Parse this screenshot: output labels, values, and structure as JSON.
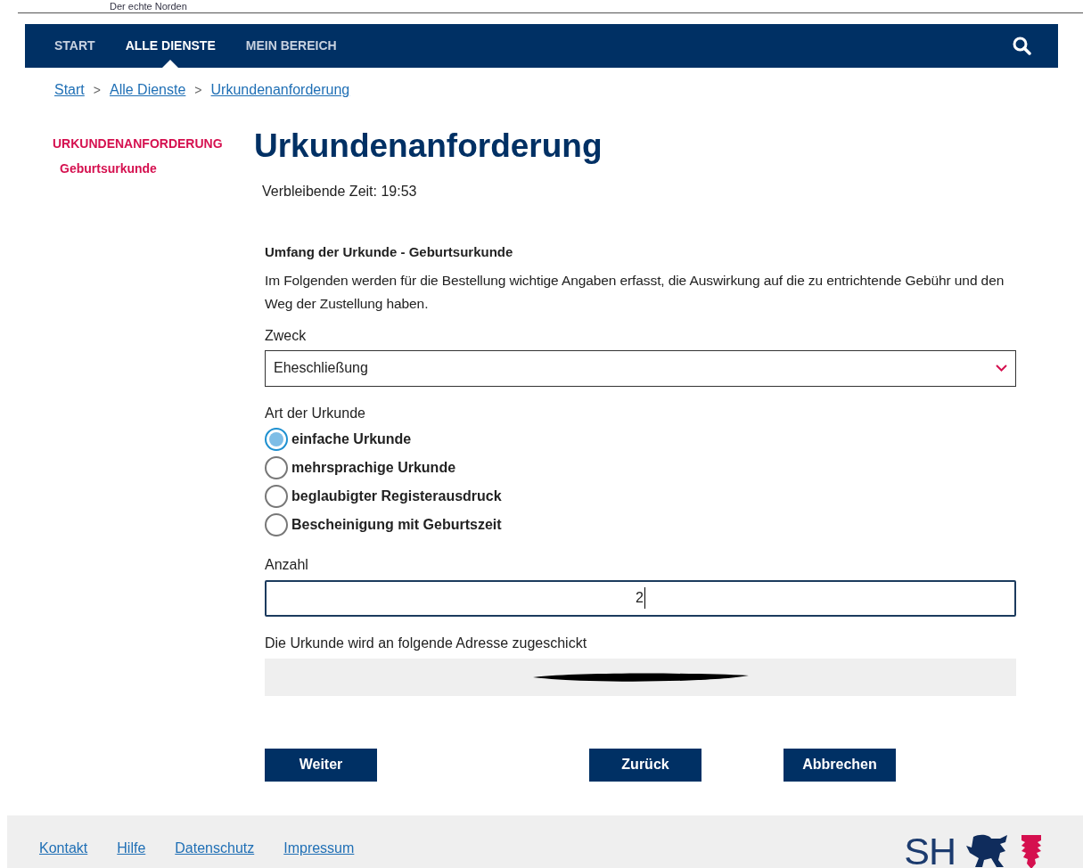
{
  "header": {
    "tagline": "Der echte Norden"
  },
  "nav": {
    "items": [
      {
        "label": "START",
        "selected": false
      },
      {
        "label": "ALLE DIENSTE",
        "selected": true
      },
      {
        "label": "MEIN BEREICH",
        "selected": false
      }
    ]
  },
  "breadcrumb": [
    "Start",
    "Alle Dienste",
    "Urkundenanforderung"
  ],
  "breadcrumb_separator": ">",
  "sidebar": {
    "title": "URKUNDENANFORDERUNG",
    "items": [
      "Geburtsurkunde"
    ]
  },
  "page": {
    "title": "Urkundenanforderung",
    "timer": "Verbleibende Zeit: 19:53"
  },
  "form": {
    "heading": "Umfang der Urkunde - Geburtsurkunde",
    "intro": "Im Folgenden werden für die Bestellung wichtige Angaben erfasst, die Auswirkung auf die zu entrichtende Gebühr und den Weg der Zustellung haben.",
    "purpose": {
      "label": "Zweck",
      "value": "Eheschließung"
    },
    "type": {
      "label": "Art der Urkunde",
      "options": [
        {
          "label": "einfache Urkunde",
          "selected": true
        },
        {
          "label": "mehrsprachige Urkunde",
          "selected": false
        },
        {
          "label": "beglaubigter Registerausdruck",
          "selected": false
        },
        {
          "label": "Bescheinigung mit Geburtszeit",
          "selected": false
        }
      ]
    },
    "count": {
      "label": "Anzahl",
      "value": "2"
    },
    "address": {
      "label": "Die Urkunde wird an folgende Adresse zugeschickt",
      "redacted": true
    }
  },
  "buttons": [
    "Weiter",
    "Zurück",
    "Abbrechen"
  ],
  "footer": {
    "links": [
      "Kontakt",
      "Hilfe",
      "Datenschutz",
      "Impressum"
    ],
    "logo_text": "SH"
  }
}
